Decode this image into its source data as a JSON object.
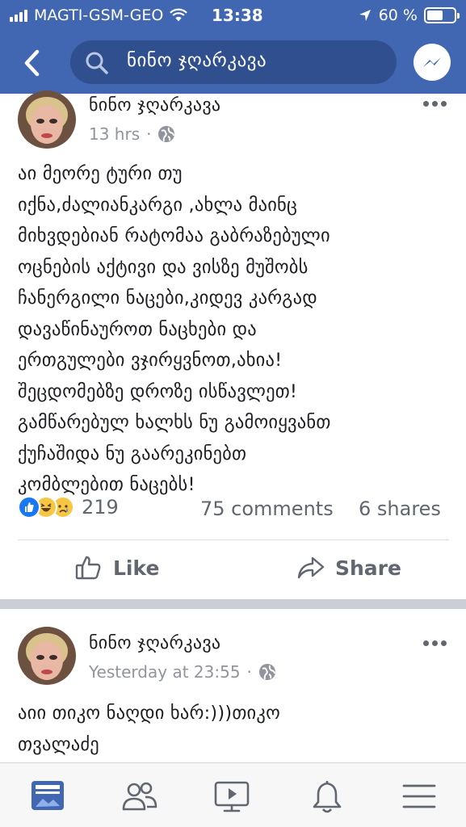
{
  "status_bar": {
    "carrier": "MAGTI-GSM-GEO",
    "time": "13:38",
    "battery_percent": "60 %",
    "battery_level": 0.6
  },
  "search": {
    "query": "ნინო ჯღარკავა"
  },
  "posts": [
    {
      "author": "ნინო ჯღარკავა",
      "time": "13 hrs",
      "separator": "·",
      "text": "აი მეორე ტური თუ\nიქნა,ძალიანკარგი ,ახლა მაინც\nმიხვდებიან რატომაა გაბრაზებული\nოცნების აქტივი და ვისზე მუშობს\nჩანერგილი ნაცები,კიდევ კარგად\nდავაწინაუროთ ნაცხები და\nერთგულები ვჯირყვნოთ,ახია!\nშეცდომებზე დროზე ისწავლეთ!\nგამწარებულ ხალხს ნუ გამოიყვანთ\nქუჩაშიდა ნუ გაარეკინებთ\nკომბლებით ნაცებს!",
      "reactions_count": "219",
      "comments": "75 comments",
      "shares": "6 shares",
      "like_label": "Like",
      "share_label": "Share"
    },
    {
      "author": "ნინო ჯღარკავა",
      "time": "Yesterday at 23:55",
      "separator": "·",
      "text": "აიი თიკო ნაღდი ხარ:)))თიკო\nთვალაძე"
    }
  ],
  "colors": {
    "brand_blue": "#4267b2",
    "search_pill": "#2f4f8f",
    "text_secondary": "#606770",
    "like_blue": "#1877f2",
    "emoji_yellow": "#f7c644"
  },
  "icons": {
    "back": "chevron-left-icon",
    "search": "search-icon",
    "messenger": "messenger-icon",
    "globe": "globe-icon",
    "more": "more-icon",
    "like": "thumbs-up-icon",
    "share": "share-arrow-icon",
    "tabs": [
      "news-feed-icon",
      "friends-icon",
      "watch-icon",
      "notifications-icon",
      "menu-icon"
    ]
  }
}
